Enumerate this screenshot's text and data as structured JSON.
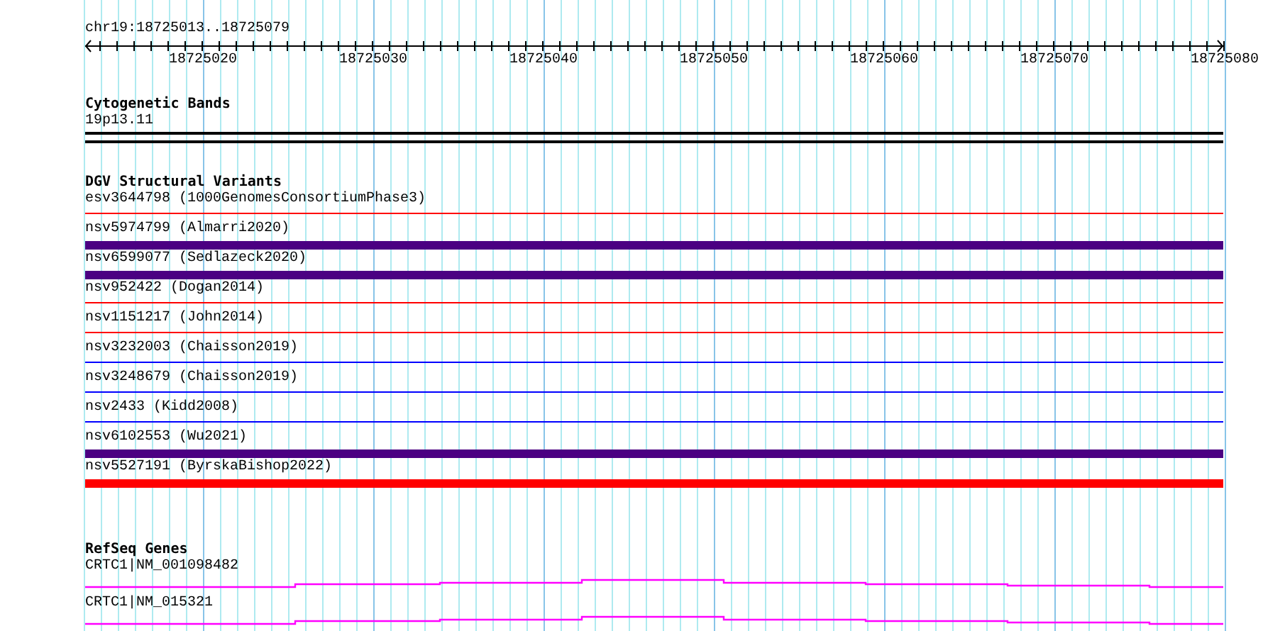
{
  "ruler": {
    "position": "chr19:18725013..18725079",
    "labels": [
      "18725020",
      "18725030",
      "18725040",
      "18725050",
      "18725060",
      "18725070",
      "18725080"
    ]
  },
  "cytogenetic_bands": {
    "title": "Cytogenetic Bands",
    "band": "19p13.11"
  },
  "dgv_structural_variants": {
    "title": "DGV Structural Variants",
    "items": [
      {
        "label": "esv3644798 (1000GenomesConsortiumPhase3)",
        "color": "#ff0000",
        "kind": "line"
      },
      {
        "label": "nsv5974799 (Almarri2020)",
        "color": "#4b0082",
        "kind": "bar"
      },
      {
        "label": "nsv6599077 (Sedlazeck2020)",
        "color": "#4b0082",
        "kind": "bar"
      },
      {
        "label": "nsv952422 (Dogan2014)",
        "color": "#ff0000",
        "kind": "line"
      },
      {
        "label": "nsv1151217 (John2014)",
        "color": "#ff0000",
        "kind": "line"
      },
      {
        "label": "nsv3232003 (Chaisson2019)",
        "color": "#0000ff",
        "kind": "line"
      },
      {
        "label": "nsv3248679 (Chaisson2019)",
        "color": "#0000ff",
        "kind": "line"
      },
      {
        "label": "nsv2433 (Kidd2008)",
        "color": "#0000ff",
        "kind": "line"
      },
      {
        "label": "nsv6102553 (Wu2021)",
        "color": "#4b0082",
        "kind": "bar"
      },
      {
        "label": "nsv5527191 (ByrskaBishop2022)",
        "color": "#ff0000",
        "kind": "bar"
      }
    ]
  },
  "refseq_genes": {
    "title": "RefSeq Genes",
    "items": [
      {
        "label": "CRTC1|NM_001098482"
      },
      {
        "label": "CRTC1|NM_015321"
      }
    ]
  }
}
